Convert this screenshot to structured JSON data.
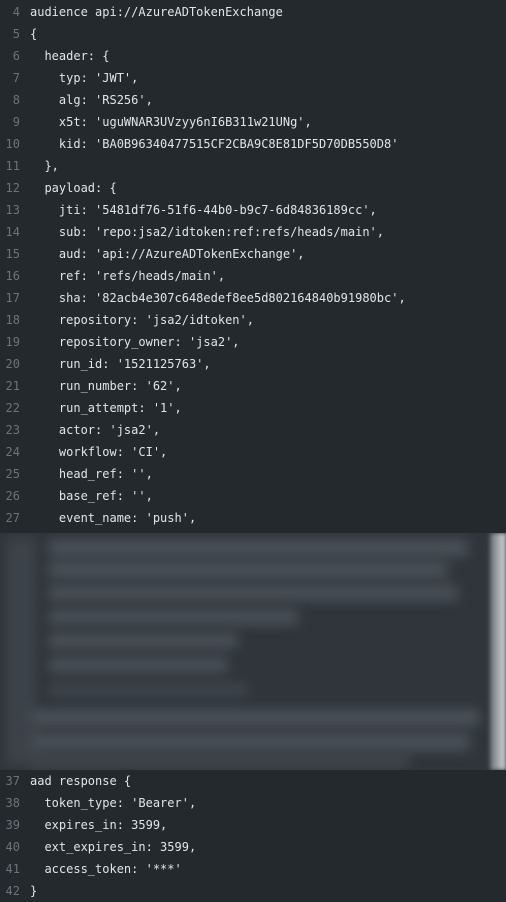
{
  "top_lines": [
    {
      "num": "4",
      "text": "audience api://AzureADTokenExchange"
    },
    {
      "num": "5",
      "text": "{"
    },
    {
      "num": "6",
      "text": "  header: {"
    },
    {
      "num": "7",
      "text": "    typ: 'JWT',"
    },
    {
      "num": "8",
      "text": "    alg: 'RS256',"
    },
    {
      "num": "9",
      "text": "    x5t: 'uguWNAR3UVzyy6nI6B311w21UNg',"
    },
    {
      "num": "10",
      "text": "    kid: 'BA0B96340477515CF2CBA9C8E81DF5D70DB550D8'"
    },
    {
      "num": "11",
      "text": "  },"
    },
    {
      "num": "12",
      "text": "  payload: {"
    },
    {
      "num": "13",
      "text": "    jti: '5481df76-51f6-44b0-b9c7-6d84836189cc',"
    },
    {
      "num": "14",
      "text": "    sub: 'repo:jsa2/idtoken:ref:refs/heads/main',"
    },
    {
      "num": "15",
      "text": "    aud: 'api://AzureADTokenExchange',"
    },
    {
      "num": "16",
      "text": "    ref: 'refs/heads/main',"
    },
    {
      "num": "17",
      "text": "    sha: '82acb4e307c648edef8ee5d802164840b91980bc',"
    },
    {
      "num": "18",
      "text": "    repository: 'jsa2/idtoken',"
    },
    {
      "num": "19",
      "text": "    repository_owner: 'jsa2',"
    },
    {
      "num": "20",
      "text": "    run_id: '1521125763',"
    },
    {
      "num": "21",
      "text": "    run_number: '62',"
    },
    {
      "num": "22",
      "text": "    run_attempt: '1',"
    },
    {
      "num": "23",
      "text": "    actor: 'jsa2',"
    },
    {
      "num": "24",
      "text": "    workflow: 'CI',"
    },
    {
      "num": "25",
      "text": "    head_ref: '',"
    },
    {
      "num": "26",
      "text": "    base_ref: '',"
    },
    {
      "num": "27",
      "text": "    event_name: 'push',"
    }
  ],
  "bottom_lines": [
    {
      "num": "37",
      "text": "aad response {"
    },
    {
      "num": "38",
      "text": "  token_type: 'Bearer',"
    },
    {
      "num": "39",
      "text": "  expires_in: 3599,"
    },
    {
      "num": "40",
      "text": "  ext_expires_in: 3599,"
    },
    {
      "num": "41",
      "text": "  access_token: '***'"
    },
    {
      "num": "42",
      "text": "}"
    }
  ]
}
